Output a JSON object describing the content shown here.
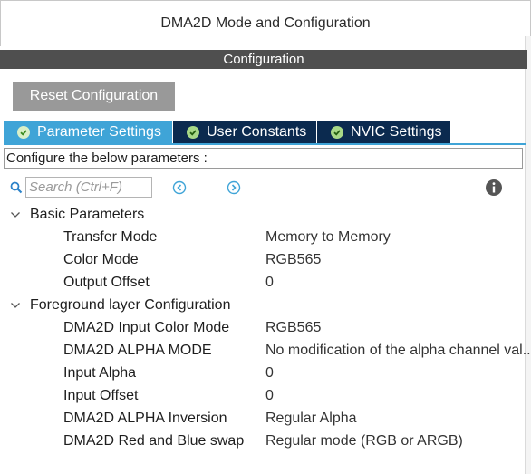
{
  "window": {
    "title": "DMA2D Mode and Configuration"
  },
  "section": {
    "title": "Configuration"
  },
  "toolbar": {
    "reset_label": "Reset Configuration"
  },
  "tabs": [
    {
      "label": "Parameter Settings",
      "active": true
    },
    {
      "label": "User Constants",
      "active": false
    },
    {
      "label": "NVIC Settings",
      "active": false
    }
  ],
  "configure": {
    "text": "Configure the below parameters :"
  },
  "search": {
    "placeholder": "Search (Ctrl+F)",
    "value": ""
  },
  "groups": [
    {
      "label": "Basic Parameters",
      "params": [
        {
          "name": "Transfer Mode",
          "value": "Memory to Memory"
        },
        {
          "name": "Color Mode",
          "value": "RGB565"
        },
        {
          "name": "Output Offset",
          "value": "0"
        }
      ]
    },
    {
      "label": "Foreground layer Configuration",
      "params": [
        {
          "name": "DMA2D Input Color Mode",
          "value": "RGB565"
        },
        {
          "name": "DMA2D ALPHA MODE",
          "value": "No modification of the alpha channel val.."
        },
        {
          "name": "Input Alpha",
          "value": "0"
        },
        {
          "name": "Input Offset",
          "value": "0"
        },
        {
          "name": "DMA2D ALPHA Inversion",
          "value": "Regular Alpha"
        },
        {
          "name": "DMA2D Red and Blue swap",
          "value": "Regular mode (RGB or ARGB)"
        }
      ]
    }
  ],
  "icons": {
    "search": "search-icon",
    "prev": "arrow-left-circle-icon",
    "next": "arrow-right-circle-icon",
    "info": "info-icon",
    "check": "check-circle-icon",
    "chevron": "chevron-down-icon"
  },
  "colors": {
    "tab_active": "#3fa4d7",
    "tab_inactive": "#0b2a4f",
    "section_bar": "#4f4f4f",
    "reset_button": "#999999"
  }
}
